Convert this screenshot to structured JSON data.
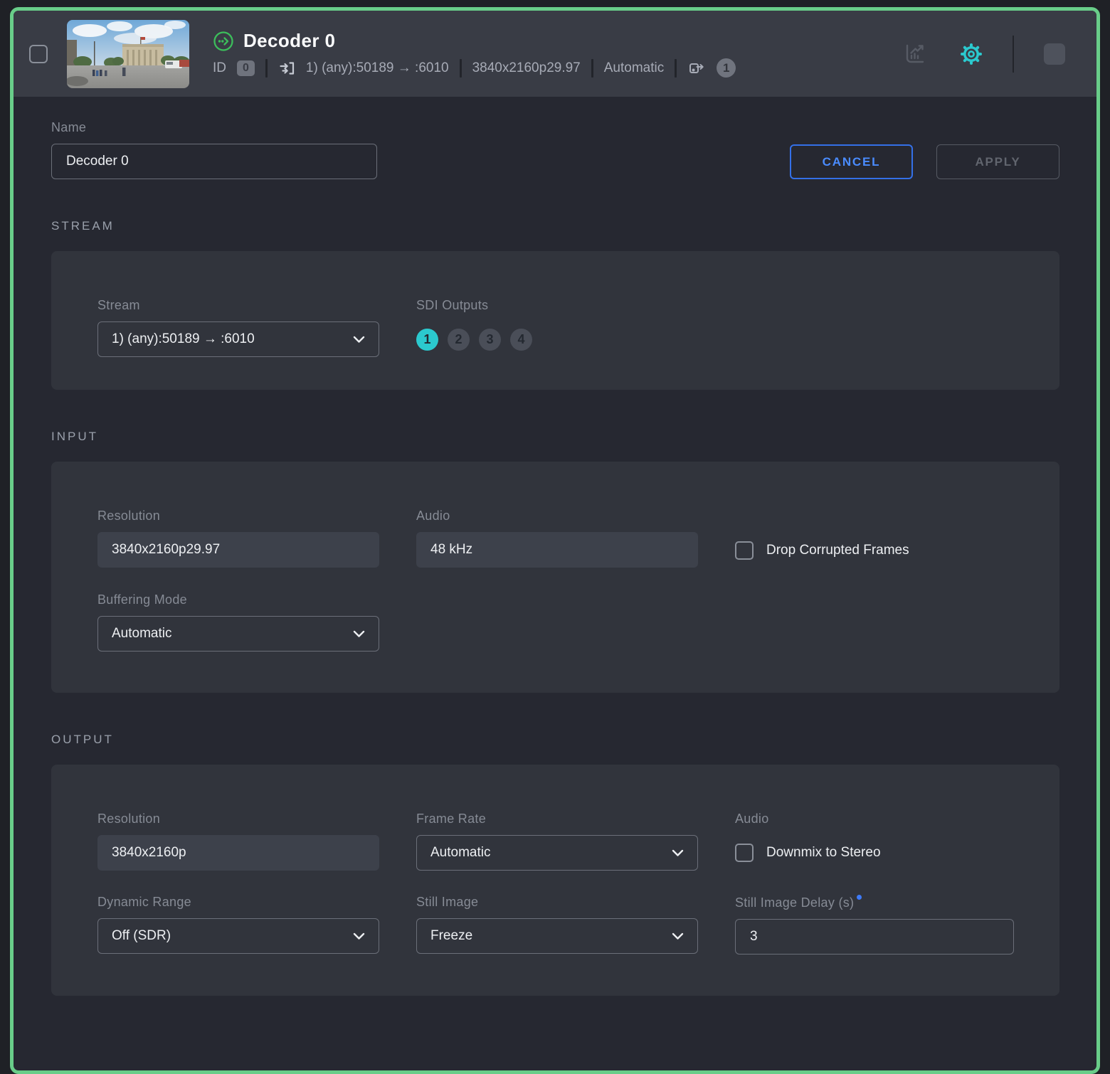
{
  "theme": {
    "accent_teal": "#2BC9CE",
    "accent_green_border": "#69CD89",
    "status_green": "#3CBE5B",
    "accent_blue": "#4A8CFF"
  },
  "header": {
    "title": "Decoder 0",
    "id_label": "ID",
    "id_value": "0",
    "stream_info": "1) (any):50189 → :6010",
    "resolution": "3840x2160p29.97",
    "mode": "Automatic",
    "output_count": "1",
    "icons": [
      "statistics-icon",
      "settings-gear-icon",
      "stop-square-button",
      "decoder-active-icon",
      "stream-input-icon",
      "sdi-output-icon"
    ]
  },
  "form": {
    "name_label": "Name",
    "name_value": "Decoder 0",
    "cancel_label": "CANCEL",
    "apply_label": "APPLY"
  },
  "stream_section": {
    "title": "STREAM",
    "stream_label": "Stream",
    "stream_value": "1) (any):50189 → :6010",
    "sdi_label": "SDI Outputs",
    "sdi_outputs": [
      {
        "label": "1",
        "active": true
      },
      {
        "label": "2",
        "active": false
      },
      {
        "label": "3",
        "active": false
      },
      {
        "label": "4",
        "active": false
      }
    ]
  },
  "input_section": {
    "title": "INPUT",
    "resolution_label": "Resolution",
    "resolution_value": "3840x2160p29.97",
    "audio_label": "Audio",
    "audio_value": "48 kHz",
    "drop_corrupted_label": "Drop Corrupted Frames",
    "buffering_label": "Buffering Mode",
    "buffering_value": "Automatic"
  },
  "output_section": {
    "title": "OUTPUT",
    "resolution_label": "Resolution",
    "resolution_value": "3840x2160p",
    "framerate_label": "Frame Rate",
    "framerate_value": "Automatic",
    "audio_label": "Audio",
    "downmix_label": "Downmix to Stereo",
    "dynamic_range_label": "Dynamic Range",
    "dynamic_range_value": "Off (SDR)",
    "still_image_label": "Still Image",
    "still_image_value": "Freeze",
    "still_delay_label": "Still Image Delay (s)",
    "still_delay_value": "3"
  }
}
